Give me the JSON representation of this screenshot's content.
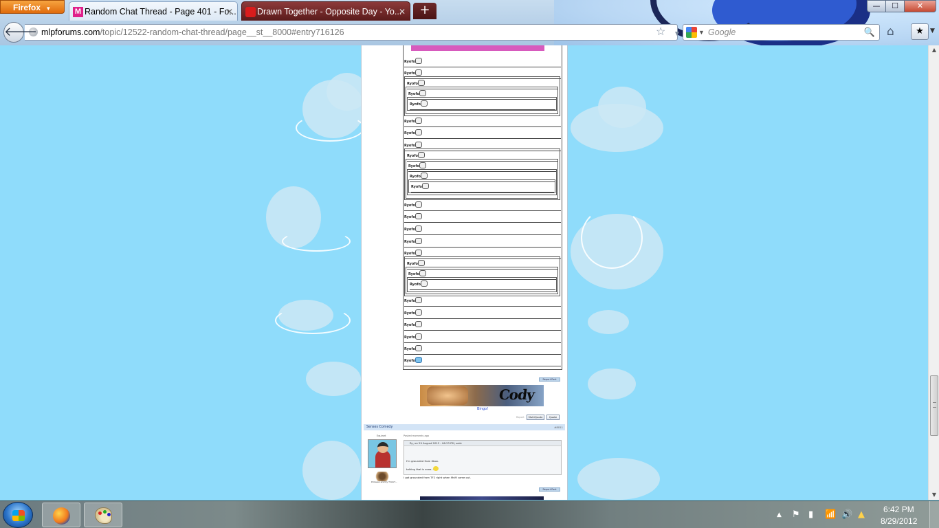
{
  "browser": {
    "menu_label": "Firefox",
    "tabs": [
      {
        "title": "Random Chat Thread - Page 401 - Fo...",
        "active": true
      },
      {
        "title": "Drawn Together - Opposite Day - Yo...",
        "active": false
      }
    ],
    "new_tab_label": "+",
    "url_domain": "mlpforums.com",
    "url_path": "/topic/12522-random-chat-thread/page__st__8000#entry716126",
    "search_placeholder": "Google",
    "window_controls": {
      "minimize": "—",
      "maximize": "☐",
      "close": "✕"
    }
  },
  "forum": {
    "quote_label": "Ryofox",
    "post1": {
      "report_btn": "Report Post",
      "sig_text": "Cody",
      "sig_link": "Bingo!",
      "report_link": "Report",
      "multiquote_btn": "MultiQuote",
      "quote_btn": "Quote"
    },
    "post2": {
      "author": "Senses Comedy",
      "post_number": "#8011",
      "rank": "Equinet",
      "posted": "Posted moments ago",
      "quote_header": "Ry, on 29 August 2012 - 06:23 PM, said:",
      "quote_line1": "I'm grounded from Xbox.",
      "quote_line2": "talking that is sooo......",
      "reply": "I got grounded from TF2 right when MvM came out.",
      "report_btn": "Report Post",
      "badge_text": "Pickasso enmity ThinkT..."
    }
  },
  "taskbar": {
    "time": "6:42 PM",
    "date": "8/29/2012"
  },
  "icons": {
    "back": "back-arrow-icon",
    "star": "bookmark-star-icon",
    "reload": "reload-icon",
    "home": "home-icon",
    "search": "magnifier-icon"
  },
  "colors": {
    "page_bg": "#8fdcfb",
    "pink_bar": "#d75abd",
    "firefox_orange": "#e06b0c",
    "post_header": "#d3e4f6"
  }
}
